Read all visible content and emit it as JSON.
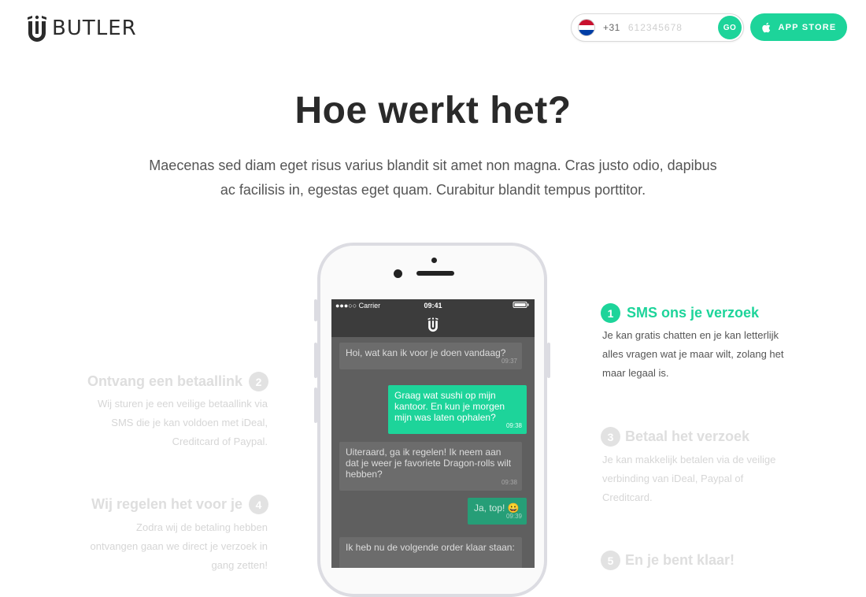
{
  "header": {
    "logo_text": "BUTLER",
    "phone": {
      "prefix": "+31",
      "placeholder": "612345678",
      "go_label": "GO"
    },
    "app_store_label": "APP STORE"
  },
  "hero": {
    "title": "Hoe werkt het?",
    "subtitle_line1": "Maecenas sed diam eget risus varius blandit sit amet non magna. Cras justo odio, dapibus",
    "subtitle_line2": "ac facilisis in, egestas eget quam. Curabitur blandit tempus porttitor."
  },
  "phone": {
    "carrier": "●●●○○ Carrier",
    "time": "09:41",
    "messages": [
      {
        "text": "Hoi, wat kan ik voor je doen vandaag?",
        "time": "09:37",
        "dir": "in"
      },
      {
        "text": "Graag wat sushi op mijn kantoor. En kun je morgen mijn was laten ophalen?",
        "time": "09:38",
        "dir": "out"
      },
      {
        "text": "Uiteraard, ga ik regelen! Ik neem aan dat je weer je favoriete Dragon-rolls wilt hebben?",
        "time": "09:38",
        "dir": "in"
      },
      {
        "text": "Ja, top! 😀",
        "time": "09:39",
        "dir": "out"
      },
      {
        "text": "Ik heb nu de volgende order klaar staan:",
        "time": "",
        "dir": "in"
      }
    ]
  },
  "steps": {
    "s1": {
      "num": "1",
      "title": "SMS ons je verzoek",
      "line1": "Je kan gratis chatten en je kan letterlijk",
      "line2": "alles vragen wat je maar wilt, zolang het",
      "line3": "maar legaal is."
    },
    "s2": {
      "num": "2",
      "title": "Ontvang een betaallink",
      "line1": "Wij sturen je een veilige betaallink via",
      "line2": "SMS die je kan voldoen met iDeal,",
      "line3": "Creditcard of Paypal."
    },
    "s3": {
      "num": "3",
      "title": "Betaal het verzoek",
      "line1": "Je kan makkelijk betalen via de veilige",
      "line2": "verbinding van iDeal, Paypal of",
      "line3": "Creditcard."
    },
    "s4": {
      "num": "4",
      "title": "Wij regelen het voor je",
      "line1": "Zodra wij de betaling hebben",
      "line2": "ontvangen gaan we direct je verzoek in",
      "line3": "gang zetten!"
    },
    "s5": {
      "num": "5",
      "title": "En je bent klaar!"
    }
  },
  "colors": {
    "accent": "#1dd49a",
    "dark": "#2a2a2a"
  }
}
